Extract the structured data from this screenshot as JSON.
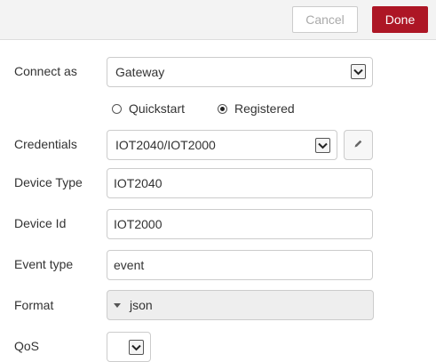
{
  "toolbar": {
    "cancel_label": "Cancel",
    "done_label": "Done"
  },
  "colors": {
    "accent": "#ad1625",
    "topbar_bg": "#f3f3f3",
    "border": "#cccccc"
  },
  "form": {
    "connect_as": {
      "label": "Connect as",
      "value": "Gateway"
    },
    "mode": {
      "options": [
        {
          "label": "Quickstart",
          "selected": false
        },
        {
          "label": "Registered",
          "selected": true
        }
      ]
    },
    "credentials": {
      "label": "Credentials",
      "value": "IOT2040/IOT2000",
      "edit_icon": "pencil-icon"
    },
    "device_type": {
      "label": "Device Type",
      "value": "IOT2040"
    },
    "device_id": {
      "label": "Device Id",
      "value": "IOT2000"
    },
    "event_type": {
      "label": "Event type",
      "value": "event"
    },
    "format": {
      "label": "Format",
      "value": "json",
      "icon": "caret-down-icon"
    },
    "qos": {
      "label": "QoS",
      "value": ""
    }
  }
}
